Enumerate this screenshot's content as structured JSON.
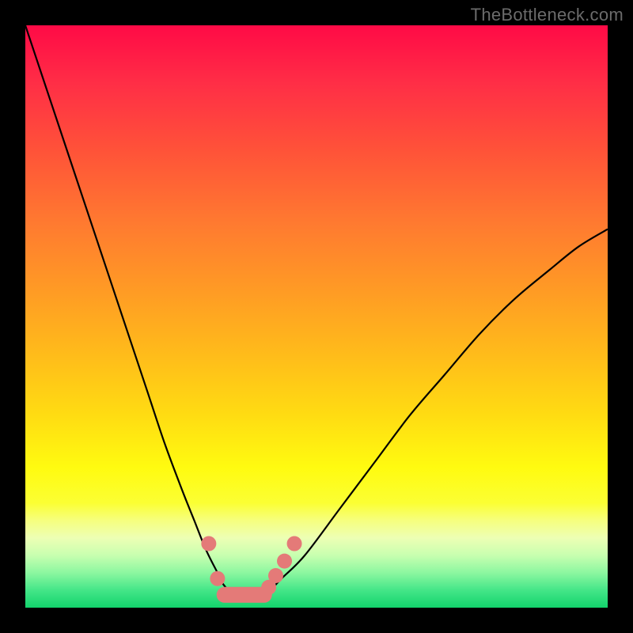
{
  "watermark": "TheBottleneck.com",
  "chart_data": {
    "type": "line",
    "title": "",
    "xlabel": "",
    "ylabel": "",
    "xlim": [
      0,
      100
    ],
    "ylim": [
      0,
      100
    ],
    "grid": false,
    "series": [
      {
        "name": "bottleneck-curve",
        "x": [
          0,
          3,
          6,
          9,
          12,
          15,
          18,
          21,
          24,
          27,
          29,
          31,
          33,
          34,
          35.5,
          37,
          40,
          41.5,
          44,
          48,
          54,
          60,
          66,
          72,
          78,
          84,
          90,
          95,
          100
        ],
        "y": [
          100,
          91,
          82,
          73,
          64,
          55,
          46,
          37,
          28,
          20,
          15,
          10,
          6,
          4,
          2.5,
          2,
          2,
          2.5,
          5,
          9,
          17,
          25,
          33,
          40,
          47,
          53,
          58,
          62,
          65
        ]
      }
    ],
    "markers": {
      "name": "threshold-markers",
      "points": [
        {
          "x": 31.5,
          "y": 11
        },
        {
          "x": 33.0,
          "y": 5
        },
        {
          "x": 41.8,
          "y": 3.5
        },
        {
          "x": 43.0,
          "y": 5.5
        },
        {
          "x": 44.5,
          "y": 8
        },
        {
          "x": 46.2,
          "y": 11
        }
      ]
    },
    "flat_segment": {
      "name": "optimal-range",
      "x_start": 34.2,
      "x_end": 41.0,
      "y": 2.2
    },
    "background": {
      "type": "vertical-gradient",
      "stops": [
        {
          "pos": 0,
          "color": "#ff0a46"
        },
        {
          "pos": 22,
          "color": "#ff5438"
        },
        {
          "pos": 46,
          "color": "#ff9c24"
        },
        {
          "pos": 67,
          "color": "#ffdc12"
        },
        {
          "pos": 82,
          "color": "#fbff33"
        },
        {
          "pos": 94,
          "color": "#8cf7a0"
        },
        {
          "pos": 100,
          "color": "#12d36c"
        }
      ]
    }
  }
}
